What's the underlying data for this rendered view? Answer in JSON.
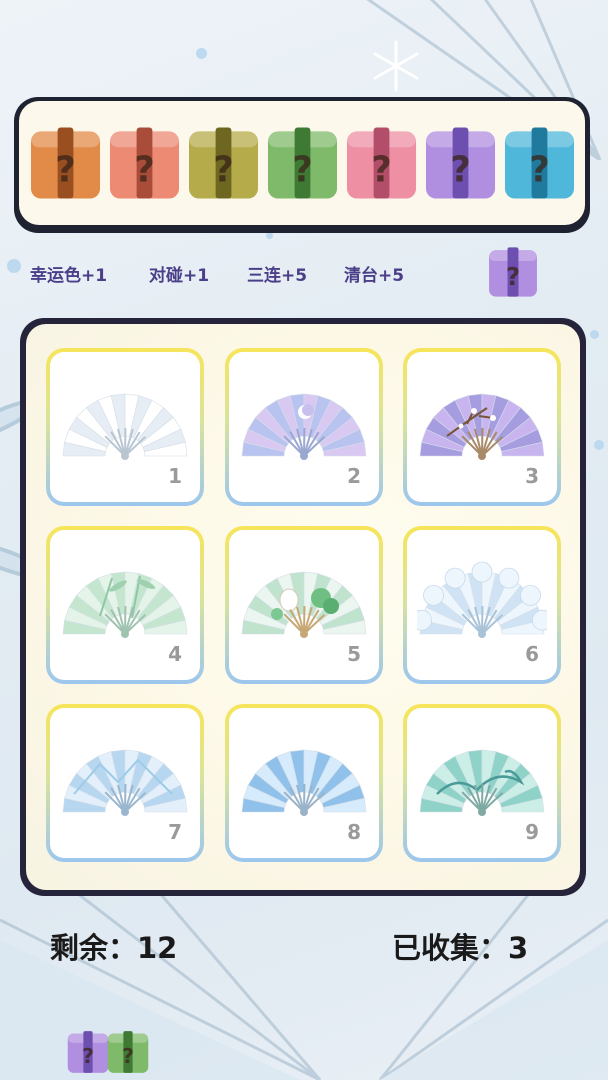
{
  "tray": {
    "slots": [
      {
        "color": "#e28b48",
        "band": "#9a4f20",
        "glyph": "?"
      },
      {
        "color": "#ec8a73",
        "band": "#a94c3a",
        "glyph": "?"
      },
      {
        "color": "#b6ab4a",
        "band": "#6d6722",
        "glyph": "?"
      },
      {
        "color": "#7fba6a",
        "band": "#3f7a35",
        "glyph": "?"
      },
      {
        "color": "#ee8fa4",
        "band": "#b34e6a",
        "glyph": "?"
      },
      {
        "color": "#b08fe0",
        "band": "#6d4fb0",
        "glyph": "?"
      },
      {
        "color": "#4fb7da",
        "band": "#1f7a9e",
        "glyph": "?"
      }
    ]
  },
  "rules": {
    "lucky": "幸运色+1",
    "pair": "对碰+1",
    "triple": "三连+5",
    "clear": "清台+5"
  },
  "next_box": {
    "color": "#b08fe0",
    "band": "#6d4fb0",
    "glyph": "?"
  },
  "grid": [
    {
      "num": "1",
      "fan": "white-plain-fan"
    },
    {
      "num": "2",
      "fan": "lavender-moon-fan"
    },
    {
      "num": "3",
      "fan": "purple-plum-blossom-fan"
    },
    {
      "num": "4",
      "fan": "green-bamboo-fan"
    },
    {
      "num": "5",
      "fan": "lotus-pond-fan"
    },
    {
      "num": "6",
      "fan": "cloud-scalloped-fan"
    },
    {
      "num": "7",
      "fan": "blue-mountain-fan"
    },
    {
      "num": "8",
      "fan": "blue-watercolor-fan"
    },
    {
      "num": "9",
      "fan": "teal-wave-fan"
    }
  ],
  "status": {
    "remaining": "剩余：12",
    "collected": "已收集：3"
  },
  "stack_boxes": [
    {
      "color": "#b08fe0",
      "band": "#6d4fb0",
      "glyph": "?"
    },
    {
      "color": "#7fba6a",
      "band": "#3f7a35",
      "glyph": "?"
    }
  ]
}
